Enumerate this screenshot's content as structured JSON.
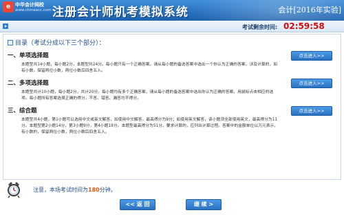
{
  "header": {
    "logo_badge": "e",
    "logo_name": "中华会计网校",
    "logo_url": "www.chinaacc.com",
    "app_title": "注册会计师机考模拟系统",
    "subject": "会计[2016年实验]"
  },
  "timer": {
    "label": "考试剩余时间:",
    "value": "02:59:58"
  },
  "directory": {
    "label": "目录（考试分成以下三个部分）："
  },
  "sections": [
    {
      "title": "一、单项选择题",
      "description": "本题型共14小题，每小题2分，本题型共24分。每小题只有一个正确答案，请从每小题的备选答案中选出一个你认为正确的答案，涉及计算的，如有小数，保留两位小数，两位小数后四舍五入。",
      "button": "点击进入>>"
    },
    {
      "title": "二、多项选择题",
      "description": "本题型共计10小题，每小题2分，共计20分。每小题均有多个正确答案，请从每小题的备选答案中选出你认为正确的答案，用鼠标点击相应的选项。每小题所有答案选择正确的得分，不答、错答、漏答均不得分。",
      "button": "点击进入>>"
    },
    {
      "title": "三、综合题",
      "description": "本题型共4小题，第1小题可以选用中文或英文解答，如使用中文解答，最高得分为9分；如使用英文解答，该小题须全部使用英文，最高得分为11分。本题型第2小题14分，第3小题9分，第4小题18分。本题型最高得分为51分。要求计算的，应列出计算过程。答案中的金额单位以万元表示，有小数的，保留两位小数，两位小数后四舍五入。",
      "button": "点击进入>>"
    }
  ],
  "footer": {
    "notice_prefix": "注意，本场考试时间为",
    "notice_value": "180",
    "notice_suffix": "分钟。",
    "back_label": "<< 返 回",
    "continue_label": "继 续 >"
  },
  "colors": {
    "header_blue": "#2a74c2",
    "timer_red": "#d10c0c",
    "notice_orange": "#e2580e"
  }
}
